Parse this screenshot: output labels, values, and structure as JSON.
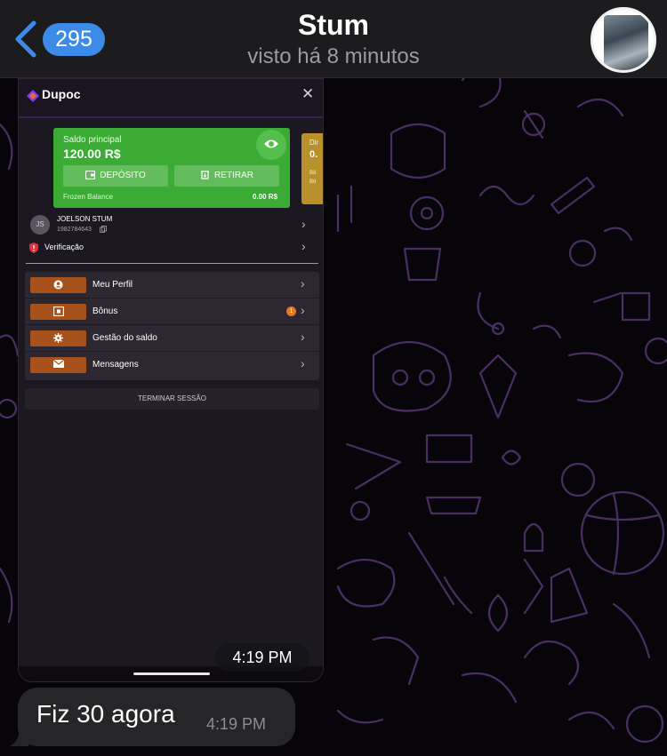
{
  "header": {
    "back_count": "295",
    "title": "Stum",
    "subtitle": "visto há 8 minutos"
  },
  "app_screenshot": {
    "brand": "Dupoc",
    "balance": {
      "label": "Saldo principal",
      "value": "120.00 R$",
      "deposit_label": "DEPÓSITO",
      "withdraw_label": "RETIRAR",
      "frozen_label": "Frozen Balance",
      "frozen_value": "0.00 R$"
    },
    "side_card": {
      "line1": "Dir",
      "line2": "0.",
      "line3": "Bô",
      "line4": "Bô"
    },
    "user": {
      "initials": "JS",
      "name": "JOELSON STUM",
      "id": "1982784643"
    },
    "verification_label": "Verificação",
    "menu": [
      {
        "label": "Meu Perfil",
        "icon": "user-icon"
      },
      {
        "label": "Bônus",
        "icon": "gift-icon",
        "badge": "1"
      },
      {
        "label": "Gestão do saldo",
        "icon": "gear-icon"
      },
      {
        "label": "Mensagens",
        "icon": "envelope-icon"
      }
    ],
    "logout_label": "TERMINAR SESSÃO"
  },
  "messages": [
    {
      "type": "image",
      "time": "4:19 PM"
    },
    {
      "type": "text",
      "text": "Fiz 30 agora",
      "time": "4:19 PM"
    }
  ],
  "colors": {
    "accent_blue": "#3d8be8",
    "balance_green": "#3bab35",
    "menu_orange": "#a7511d",
    "side_card_gold": "#b8912c"
  }
}
